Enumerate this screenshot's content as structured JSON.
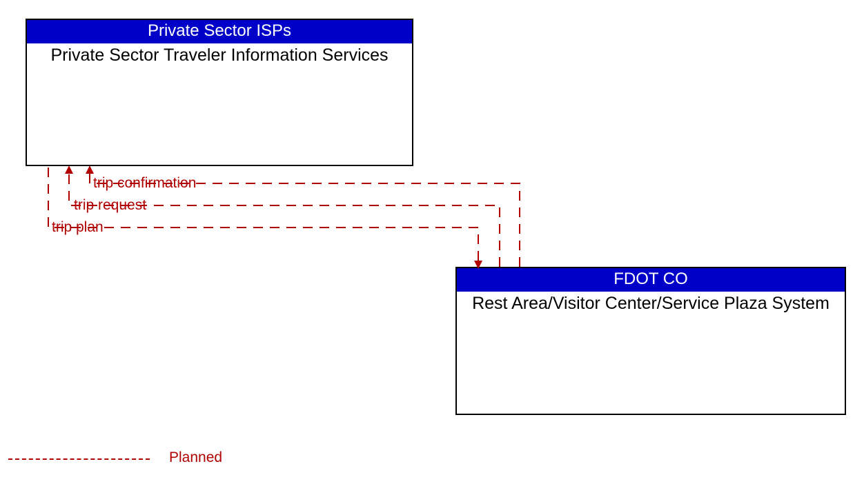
{
  "entities": {
    "top": {
      "header": "Private Sector ISPs",
      "body": "Private Sector Traveler Information Services"
    },
    "bottom": {
      "header": "FDOT CO",
      "body": "Rest Area/Visitor Center/Service Plaza System"
    }
  },
  "flows": {
    "trip_confirmation": "trip confirmation",
    "trip_request": "trip request",
    "trip_plan": "trip plan"
  },
  "legend": {
    "planned": "Planned"
  },
  "colors": {
    "header_bg": "#0000c8",
    "flow": "#b00000"
  }
}
